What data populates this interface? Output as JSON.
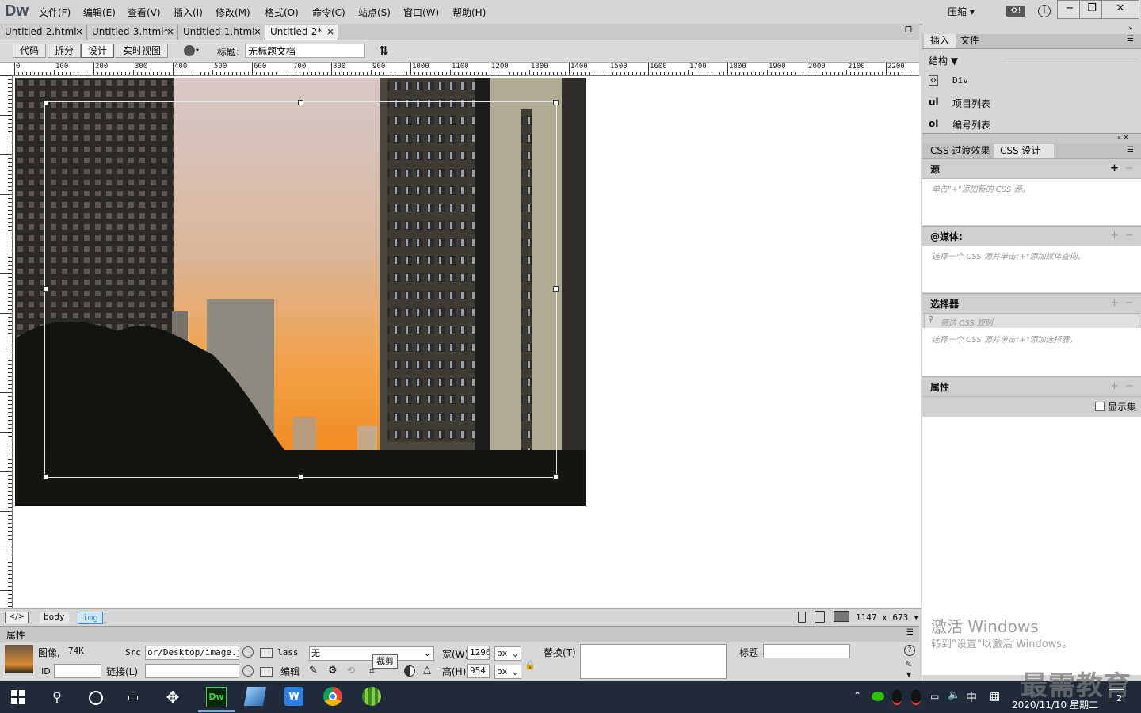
{
  "app": {
    "logo": "Dw",
    "menus": [
      "文件(F)",
      "编辑(E)",
      "查看(V)",
      "插入(I)",
      "修改(M)",
      "格式(O)",
      "命令(C)",
      "站点(S)",
      "窗口(W)",
      "帮助(H)"
    ],
    "compress_label": "压缩",
    "window_controls": [
      "minimize-icon",
      "restore-icon",
      "close-icon"
    ]
  },
  "tabs": [
    {
      "label": "Untitled-2.html",
      "active": false
    },
    {
      "label": "Untitled-3.html*",
      "active": false
    },
    {
      "label": "Untitled-1.html",
      "active": false
    },
    {
      "label": "Untitled-2*",
      "active": true
    }
  ],
  "toolbar": {
    "views": [
      "代码",
      "拆分",
      "设计",
      "实时视图"
    ],
    "active_view": "设计",
    "title_label": "标题:",
    "title_value": "无标题文档"
  },
  "ruler": {
    "h_labels": [
      "0",
      "100",
      "200",
      "300",
      "400",
      "500",
      "600",
      "700",
      "800",
      "900",
      "1000",
      "1100",
      "1200",
      "1300",
      "1400",
      "1500",
      "1600",
      "1700",
      "1800",
      "1900",
      "2000",
      "2100",
      "2200"
    ]
  },
  "status": {
    "tags": [
      "body",
      "img"
    ],
    "selected_tag": "img",
    "size": "1147 x 673"
  },
  "properties": {
    "header": "属性",
    "image_label": "图像,",
    "image_size": "74K",
    "id_label": "ID",
    "id_value": "",
    "src_label": "Src",
    "src_value": "or/Desktop/image.jpg",
    "link_label": "链接(L)",
    "link_value": "",
    "class_label": "lass",
    "class_value": "无",
    "edit_label": "编辑",
    "tooltip": "裁剪",
    "width_label": "宽(W)",
    "width_value": "1296",
    "height_label": "高(H)",
    "height_value": "954",
    "unit": "px",
    "alt_label": "替换(T)",
    "title_label": "标题",
    "title_value": ""
  },
  "right_panel": {
    "tabs_top": [
      "插入",
      "文件"
    ],
    "insert_category": "结构",
    "insert_items": [
      {
        "icon": "‹›",
        "label": "Div"
      },
      {
        "icon": "ul",
        "label": "项目列表"
      },
      {
        "icon": "ol",
        "label": "编号列表"
      }
    ],
    "tabs_css": [
      "CSS 过渡效果",
      "CSS 设计器"
    ],
    "sources_title": "源",
    "sources_hint": "单击\"+\"添加新的 CSS 源。",
    "media_title": "@媒体:",
    "media_hint": "选择一个 CSS 源并单击\"+\"添加媒体查询。",
    "selectors_title": "选择器",
    "selectors_filter": "筛选 CSS 规则",
    "selectors_hint": "选择一个 CSS 源并单击\"+\"添加选择器。",
    "properties_title": "属性",
    "show_set_label": "显示集"
  },
  "watermark": {
    "line1": "激活 Windows",
    "line2": "转到\"设置\"以激活 Windows。",
    "brand": "最需教育"
  },
  "taskbar": {
    "ime": "中",
    "date": "2020/11/10 星期二",
    "notification_count": "2"
  },
  "colors": {
    "accent": "#3c8fd6",
    "dw_green": "#3ccf3c",
    "taskbar": "#1f2b3a"
  }
}
